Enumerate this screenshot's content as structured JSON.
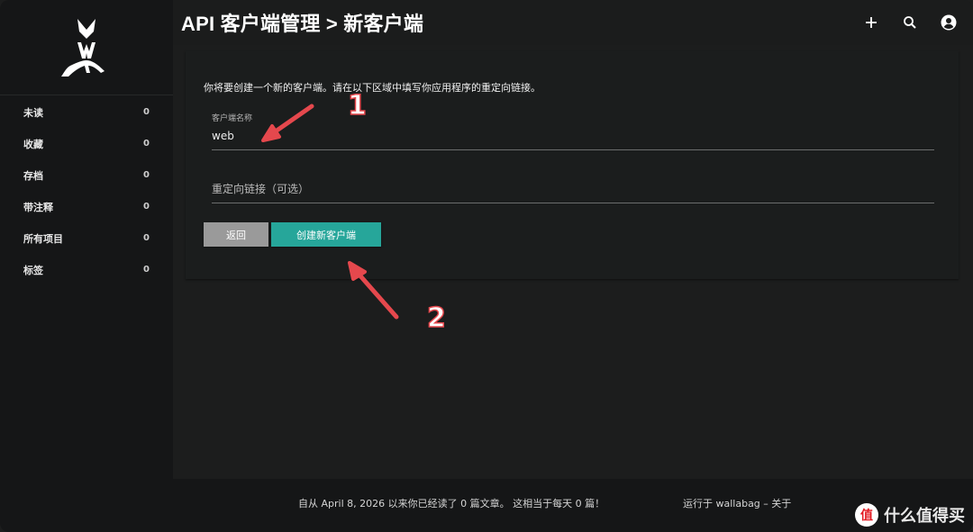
{
  "header": {
    "title": "API 客户端管理 > 新客户端",
    "icons": [
      "plus-icon",
      "search-icon",
      "account-icon"
    ]
  },
  "sidebar": {
    "items": [
      {
        "label": "未读",
        "count": "0"
      },
      {
        "label": "收藏",
        "count": "0"
      },
      {
        "label": "存档",
        "count": "0"
      },
      {
        "label": "带注释",
        "count": "0"
      },
      {
        "label": "所有项目",
        "count": "0"
      },
      {
        "label": "标签",
        "count": "0"
      }
    ]
  },
  "form": {
    "intro": "你将要创建一个新的客户端。请在以下区域中填写你应用程序的重定向链接。",
    "client_name_label": "客户端名称",
    "client_name_value": "web",
    "redirect_placeholder": "重定向链接（可选）",
    "back_label": "返回",
    "create_label": "创建新客户端"
  },
  "footer": {
    "stats": "自从 April 8, 2026 以来你已经读了 0 篇文章。 这相当于每天 0 篇！",
    "powered": "运行于 wallabag – 关于",
    "watermark": "什么值得买",
    "watermark_badge": "值"
  },
  "annotations": {
    "step1": "1",
    "step2": "2",
    "color": "#e5484d"
  },
  "colors": {
    "accent": "#26a69a",
    "back_button": "#9a9a9a",
    "background": "#1c1d1d",
    "sidebar": "#151617"
  }
}
